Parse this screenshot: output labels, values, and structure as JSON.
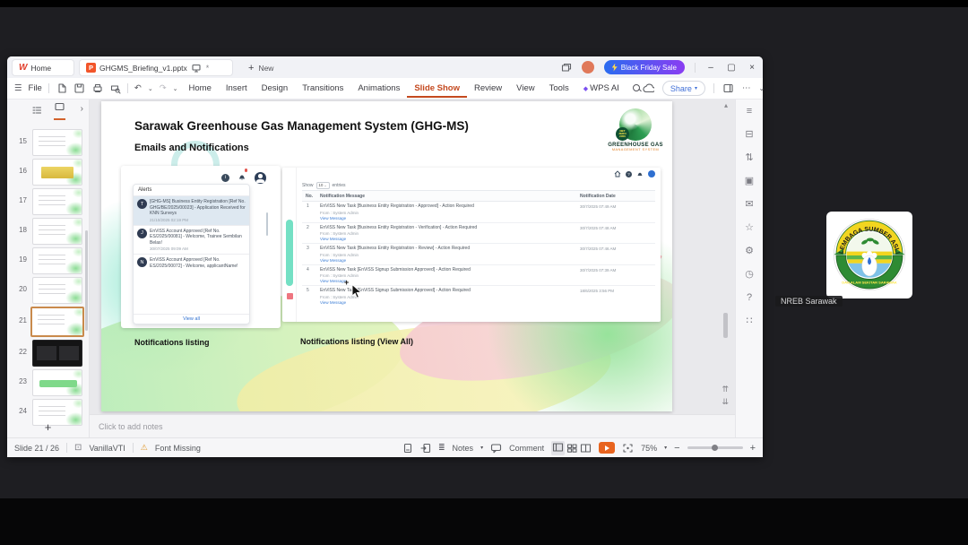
{
  "icons": {
    "wps_logo": "W",
    "ppt_badge": "P",
    "unsaved": "*",
    "hamburger": "☰",
    "undo": "↶",
    "redo": "↷",
    "caret": "⌄",
    "caret_small": "▾",
    "chevron_right": "›",
    "minimize": "–",
    "maximize": "▢",
    "close": "×",
    "ellipsis": "⋯",
    "plus": "+",
    "sparkle": "◆",
    "info": "i",
    "question": "?",
    "warning": "⚠",
    "theme": "⊡",
    "notes_lines": "≣",
    "scroll_up": "▴",
    "prev_slide": "⇈",
    "next_slide": "⇊",
    "minus": "−",
    "cursor_plus": "+",
    "rail": [
      "≡",
      "⊟",
      "⇅",
      "▣",
      "✉",
      "☆",
      "⚙",
      "◷",
      "?",
      "∷"
    ]
  },
  "window": {
    "titlebar": {
      "home_tab": "Home",
      "doc_tab": "GHGMS_Briefing_v1.pptx",
      "new_label": "New",
      "promo": "Black Friday Sale"
    },
    "menubar": {
      "file": "File",
      "items": [
        "Home",
        "Insert",
        "Design",
        "Transitions",
        "Animations",
        "Slide Show",
        "Review",
        "View",
        "Tools",
        "WPS AI"
      ],
      "share": "Share"
    }
  },
  "sidebar": {
    "slides": [
      {
        "num": "15"
      },
      {
        "num": "16"
      },
      {
        "num": "17"
      },
      {
        "num": "18"
      },
      {
        "num": "19"
      },
      {
        "num": "20"
      },
      {
        "num": "21"
      },
      {
        "num": "22"
      },
      {
        "num": "23"
      },
      {
        "num": "24"
      }
    ]
  },
  "slide": {
    "title": "Sarawak Greenhouse Gas Management System (GHG-MS)",
    "subtitle": "Emails and Notifications",
    "logo": {
      "line1": "GREENHOUSE GAS",
      "line2": "MANAGEMENT SYSTEM",
      "badge": "NET ZERO 2050"
    },
    "alerts": {
      "header": "Alerts",
      "view_all": "View all",
      "items": [
        {
          "initial": "T",
          "text": "[GHG-MS] Business Entity Registration [Ref No. GHG/BE/2025/00023] - Application Received for KNN Surveys",
          "time": "21/10/2025 02:19 PM"
        },
        {
          "initial": "J",
          "text": "EnViSS Account Approved [Ref No. ES/2025/00081] - Welcome, Trainee Sembilan Belas!",
          "time": "30/07/2025 09:09 AM"
        },
        {
          "initial": "N",
          "text": "EnViSS Account Approved [Ref No. ES/2025/00072] - Welcome, applicantName!",
          "time": ""
        }
      ]
    },
    "table": {
      "show": "Show",
      "show_value": "10",
      "entries": "entries",
      "columns": [
        "No.",
        "Notification Message",
        "Notification Date"
      ],
      "rows": [
        {
          "no": "1",
          "message": "EnViSS New Task [Business Entity Registration - Approved] - Action Required",
          "from": "From : System Admin",
          "link": "View Message",
          "date": "30/7/2025 07:49 AM"
        },
        {
          "no": "2",
          "message": "EnViSS New Task [Business Entity Registration - Verification] - Action Required",
          "from": "From : System Admin",
          "link": "View Message",
          "date": "30/7/2025 07:48 AM"
        },
        {
          "no": "3",
          "message": "EnViSS New Task [Business Entity Registration - Review] - Action Required",
          "from": "From : System Admin",
          "link": "View Message",
          "date": "30/7/2025 07:46 AM"
        },
        {
          "no": "4",
          "message": "EnViSS New Task [EnViSS Signup Submission Approved] - Action Required",
          "from": "From : System Admin",
          "link": "View Message",
          "date": "30/7/2025 07:39 AM"
        },
        {
          "no": "5",
          "message": "EnViSS New Task [EnViSS Signup Submission Approved] - Action Required",
          "from": "From : System Admin",
          "link": "View Message",
          "date": "18/6/2025 3:56 PM"
        }
      ]
    },
    "captions": {
      "left": "Notifications listing",
      "right": "Notifications listing (View All)"
    }
  },
  "notes": {
    "placeholder": "Click to add notes"
  },
  "statusbar": {
    "slide_indicator": "Slide 21 / 26",
    "theme": "VanillaVTI",
    "font_missing": "Font Missing",
    "notes_label": "Notes",
    "comment_label": "Comment",
    "zoom": "75%"
  },
  "meeting": {
    "participant": "NREB Sarawak",
    "emblem_top": "LEMBAGA SUMBER ASLI",
    "emblem_bottom": "DAN ALAM SEKITAR SARAWAK"
  }
}
